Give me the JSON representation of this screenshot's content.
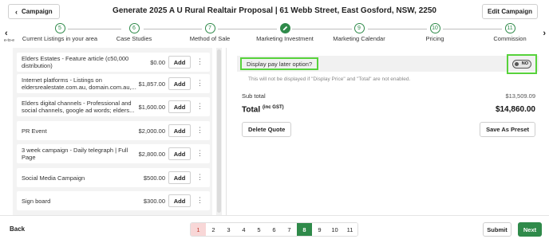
{
  "header": {
    "campaign_label": "Campaign",
    "title": "Generate 2025 A U Rural Realtair Proposal | 61 Webb Street, East Gosford, NSW, 2250",
    "edit_label": "Edit Campaign"
  },
  "steps": {
    "prev_label": "e-to-e",
    "items": [
      {
        "num": "5",
        "label": "Current Listings in your area"
      },
      {
        "num": "6",
        "label": "Case Studies"
      },
      {
        "num": "7",
        "label": "Method of Sale"
      },
      {
        "num": "",
        "label": "Marketing Investment",
        "icon": "pencil-icon",
        "active": true
      },
      {
        "num": "9",
        "label": "Marketing Calendar"
      },
      {
        "num": "10",
        "label": "Pricing"
      },
      {
        "num": "11",
        "label": "Commission"
      }
    ]
  },
  "items": [
    {
      "label": "Elders Estates - Feature article (c50,000 distribution)",
      "price": "$0.00",
      "add": "Add"
    },
    {
      "label": "Internet platforms - Listings on eldersrealestate.com.au, domain.com.au,...",
      "price": "$1,857.00",
      "add": "Add"
    },
    {
      "label": "Elders digital channels - Professional and social channels, google ad words; elders...",
      "price": "$1,600.00",
      "add": "Add"
    },
    {
      "label": "PR Event",
      "price": "$2,000.00",
      "add": "Add"
    },
    {
      "label": "3 week campaign - Daily telegraph | Full Page",
      "price": "$2,800.00",
      "add": "Add"
    },
    {
      "label": "Social Media Campaign",
      "price": "$500.00",
      "add": "Add"
    },
    {
      "label": "Sign board",
      "price": "$300.00",
      "add": "Add"
    }
  ],
  "summary": {
    "pay_later_label": "Display pay later option?",
    "toggle_label": "NO",
    "note": "This will not be displayed if \"Display Price\" and \"Total\" are not enabled.",
    "subtotal_label": "Sub total",
    "subtotal_value": "$13,509.09",
    "total_label": "Total",
    "total_suffix": "(inc GST)",
    "total_value": "$14,860.00",
    "delete_label": "Delete Quote",
    "preset_label": "Save As Preset"
  },
  "footer": {
    "back_label": "Back",
    "pages": [
      "1",
      "2",
      "3",
      "4",
      "5",
      "6",
      "7",
      "8",
      "9",
      "10",
      "11"
    ],
    "current_page": "8",
    "submit_label": "Submit",
    "next_label": "Next"
  },
  "colors": {
    "accent": "#2f8a4a",
    "highlight": "#57d23b"
  }
}
